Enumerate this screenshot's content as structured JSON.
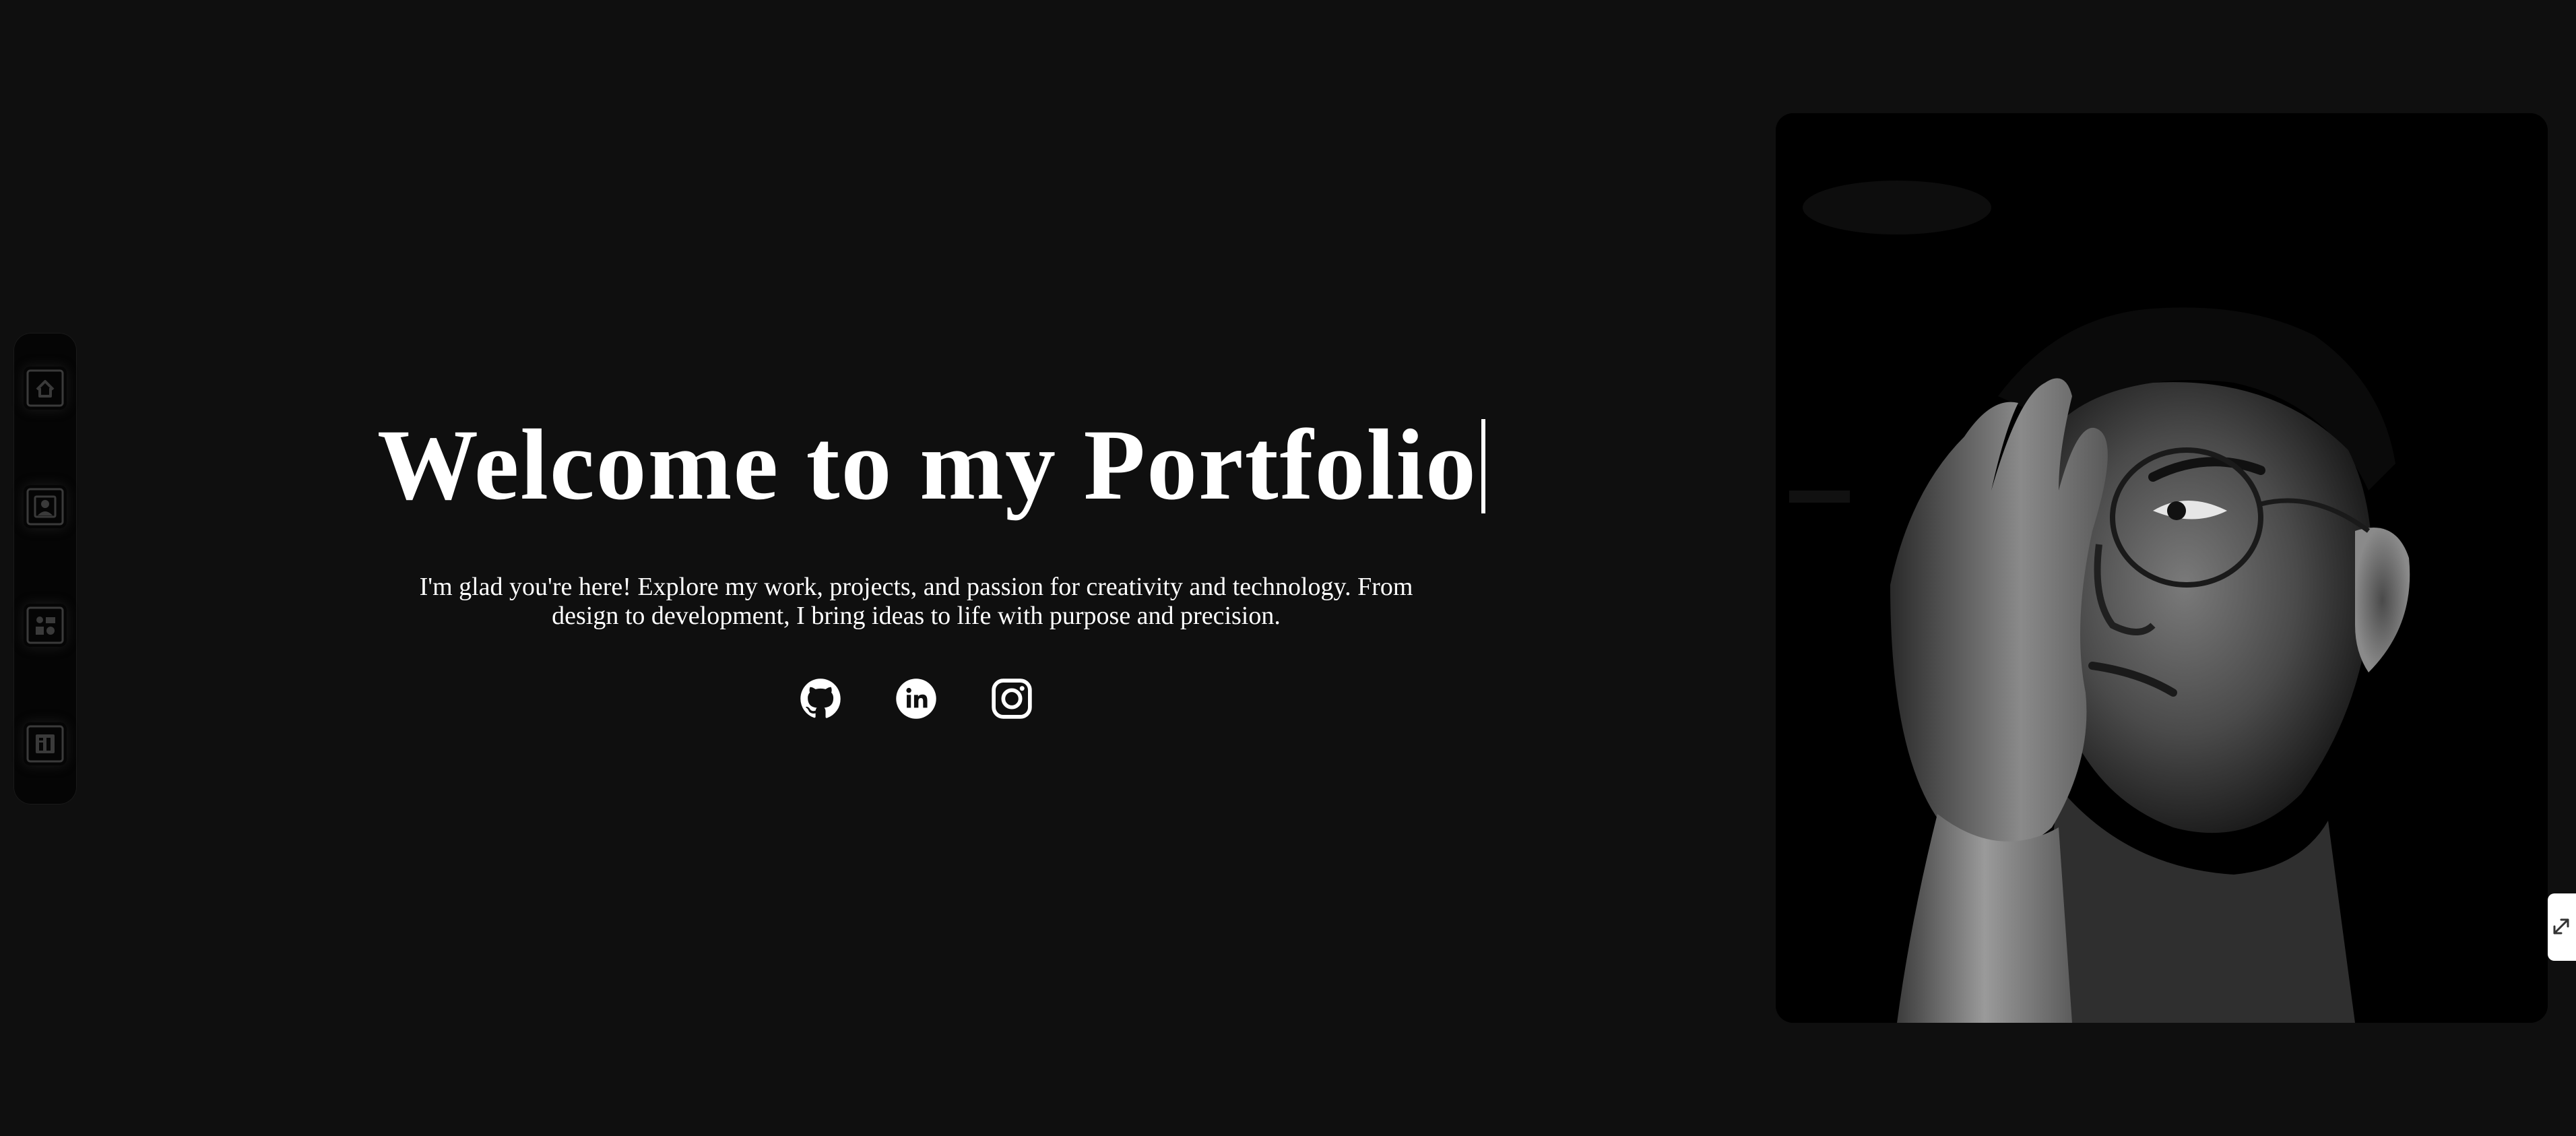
{
  "hero": {
    "title": "Welcome to my Portfolio",
    "paragraph": "I'm glad you're here! Explore my work, projects, and passion for creativity and technology. From design to development, I bring ideas to life with purpose and precision."
  },
  "nav": {
    "items": [
      {
        "icon": "home-icon"
      },
      {
        "icon": "about-icon"
      },
      {
        "icon": "projects-icon"
      },
      {
        "icon": "skills-icon"
      }
    ]
  },
  "socials": [
    {
      "icon": "github-icon"
    },
    {
      "icon": "linkedin-icon"
    },
    {
      "icon": "instagram-icon"
    }
  ],
  "colors": {
    "background": "#0f0f0f",
    "text": "#ffffff",
    "dock": "#050505",
    "portrait_bg": "#000000"
  }
}
